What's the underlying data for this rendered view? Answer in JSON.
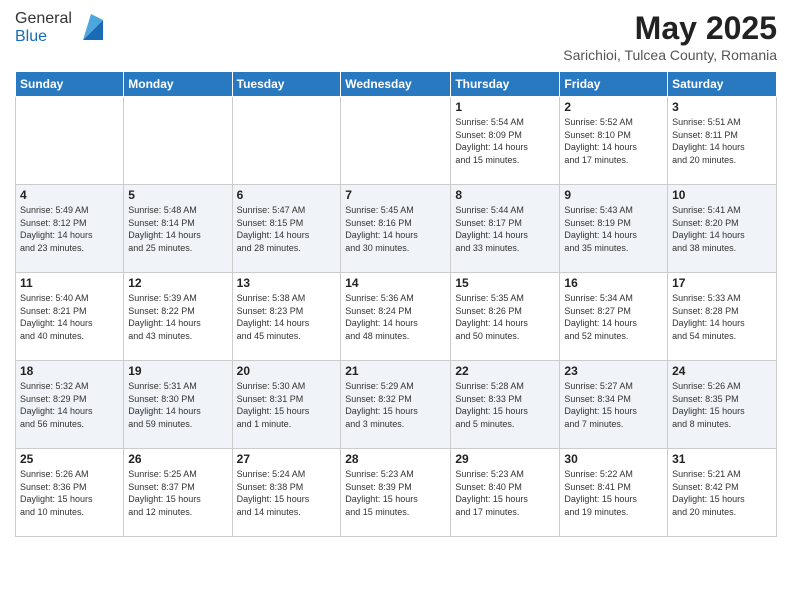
{
  "header": {
    "logo_general": "General",
    "logo_blue": "Blue",
    "main_title": "May 2025",
    "subtitle": "Sarichioi, Tulcea County, Romania"
  },
  "days_of_week": [
    "Sunday",
    "Monday",
    "Tuesday",
    "Wednesday",
    "Thursday",
    "Friday",
    "Saturday"
  ],
  "weeks": [
    [
      {
        "day": "",
        "info": ""
      },
      {
        "day": "",
        "info": ""
      },
      {
        "day": "",
        "info": ""
      },
      {
        "day": "",
        "info": ""
      },
      {
        "day": "1",
        "info": "Sunrise: 5:54 AM\nSunset: 8:09 PM\nDaylight: 14 hours\nand 15 minutes."
      },
      {
        "day": "2",
        "info": "Sunrise: 5:52 AM\nSunset: 8:10 PM\nDaylight: 14 hours\nand 17 minutes."
      },
      {
        "day": "3",
        "info": "Sunrise: 5:51 AM\nSunset: 8:11 PM\nDaylight: 14 hours\nand 20 minutes."
      }
    ],
    [
      {
        "day": "4",
        "info": "Sunrise: 5:49 AM\nSunset: 8:12 PM\nDaylight: 14 hours\nand 23 minutes."
      },
      {
        "day": "5",
        "info": "Sunrise: 5:48 AM\nSunset: 8:14 PM\nDaylight: 14 hours\nand 25 minutes."
      },
      {
        "day": "6",
        "info": "Sunrise: 5:47 AM\nSunset: 8:15 PM\nDaylight: 14 hours\nand 28 minutes."
      },
      {
        "day": "7",
        "info": "Sunrise: 5:45 AM\nSunset: 8:16 PM\nDaylight: 14 hours\nand 30 minutes."
      },
      {
        "day": "8",
        "info": "Sunrise: 5:44 AM\nSunset: 8:17 PM\nDaylight: 14 hours\nand 33 minutes."
      },
      {
        "day": "9",
        "info": "Sunrise: 5:43 AM\nSunset: 8:19 PM\nDaylight: 14 hours\nand 35 minutes."
      },
      {
        "day": "10",
        "info": "Sunrise: 5:41 AM\nSunset: 8:20 PM\nDaylight: 14 hours\nand 38 minutes."
      }
    ],
    [
      {
        "day": "11",
        "info": "Sunrise: 5:40 AM\nSunset: 8:21 PM\nDaylight: 14 hours\nand 40 minutes."
      },
      {
        "day": "12",
        "info": "Sunrise: 5:39 AM\nSunset: 8:22 PM\nDaylight: 14 hours\nand 43 minutes."
      },
      {
        "day": "13",
        "info": "Sunrise: 5:38 AM\nSunset: 8:23 PM\nDaylight: 14 hours\nand 45 minutes."
      },
      {
        "day": "14",
        "info": "Sunrise: 5:36 AM\nSunset: 8:24 PM\nDaylight: 14 hours\nand 48 minutes."
      },
      {
        "day": "15",
        "info": "Sunrise: 5:35 AM\nSunset: 8:26 PM\nDaylight: 14 hours\nand 50 minutes."
      },
      {
        "day": "16",
        "info": "Sunrise: 5:34 AM\nSunset: 8:27 PM\nDaylight: 14 hours\nand 52 minutes."
      },
      {
        "day": "17",
        "info": "Sunrise: 5:33 AM\nSunset: 8:28 PM\nDaylight: 14 hours\nand 54 minutes."
      }
    ],
    [
      {
        "day": "18",
        "info": "Sunrise: 5:32 AM\nSunset: 8:29 PM\nDaylight: 14 hours\nand 56 minutes."
      },
      {
        "day": "19",
        "info": "Sunrise: 5:31 AM\nSunset: 8:30 PM\nDaylight: 14 hours\nand 59 minutes."
      },
      {
        "day": "20",
        "info": "Sunrise: 5:30 AM\nSunset: 8:31 PM\nDaylight: 15 hours\nand 1 minute."
      },
      {
        "day": "21",
        "info": "Sunrise: 5:29 AM\nSunset: 8:32 PM\nDaylight: 15 hours\nand 3 minutes."
      },
      {
        "day": "22",
        "info": "Sunrise: 5:28 AM\nSunset: 8:33 PM\nDaylight: 15 hours\nand 5 minutes."
      },
      {
        "day": "23",
        "info": "Sunrise: 5:27 AM\nSunset: 8:34 PM\nDaylight: 15 hours\nand 7 minutes."
      },
      {
        "day": "24",
        "info": "Sunrise: 5:26 AM\nSunset: 8:35 PM\nDaylight: 15 hours\nand 8 minutes."
      }
    ],
    [
      {
        "day": "25",
        "info": "Sunrise: 5:26 AM\nSunset: 8:36 PM\nDaylight: 15 hours\nand 10 minutes."
      },
      {
        "day": "26",
        "info": "Sunrise: 5:25 AM\nSunset: 8:37 PM\nDaylight: 15 hours\nand 12 minutes."
      },
      {
        "day": "27",
        "info": "Sunrise: 5:24 AM\nSunset: 8:38 PM\nDaylight: 15 hours\nand 14 minutes."
      },
      {
        "day": "28",
        "info": "Sunrise: 5:23 AM\nSunset: 8:39 PM\nDaylight: 15 hours\nand 15 minutes."
      },
      {
        "day": "29",
        "info": "Sunrise: 5:23 AM\nSunset: 8:40 PM\nDaylight: 15 hours\nand 17 minutes."
      },
      {
        "day": "30",
        "info": "Sunrise: 5:22 AM\nSunset: 8:41 PM\nDaylight: 15 hours\nand 19 minutes."
      },
      {
        "day": "31",
        "info": "Sunrise: 5:21 AM\nSunset: 8:42 PM\nDaylight: 15 hours\nand 20 minutes."
      }
    ]
  ]
}
